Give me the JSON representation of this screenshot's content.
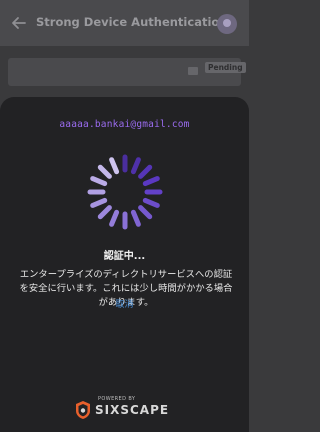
{
  "app": {
    "title": "Strong Device Authentication"
  },
  "background": {
    "badge": "Pending"
  },
  "modal": {
    "email": "aaaaa.bankai@gmail.com",
    "status": "認証中...",
    "message": "エンタープライズのディレクトリサービスへの認証を安全に行います。これには少し時間がかかる場合があります。",
    "cancel_label": "取消"
  },
  "branding": {
    "powered_by": "POWERED BY",
    "name": "SIXSCAPE"
  },
  "colors": {
    "accent": "#9b6cf0",
    "link": "#4a90d9",
    "sheet": "#222224"
  },
  "icons": [
    "back-arrow-icon",
    "avatar-icon",
    "loading-spinner-icon",
    "sixscape-logo-icon"
  ]
}
